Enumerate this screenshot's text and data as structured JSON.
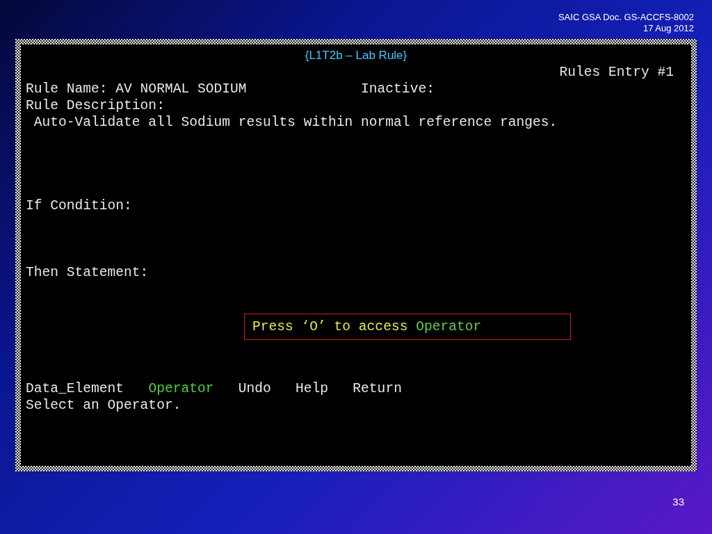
{
  "slide": {
    "doc_id": "SAIC GSA Doc. GS-ACCFS-8002",
    "date": "17 Aug 2012",
    "page_number": "33"
  },
  "terminal": {
    "title": "{L1T2b – Lab Rule}",
    "entry": "Rules Entry #1",
    "rule_name_label": "Rule Name: AV NORMAL SODIUM",
    "inactive_label": "Inactive:",
    "description_label": "Rule Description:",
    "description": "Auto-Validate all Sodium results within normal reference ranges.",
    "if_label": "If Condition:",
    "then_label": "Then Statement:",
    "menu": [
      {
        "label": "Data_Element",
        "selected": false
      },
      {
        "label": "Operator",
        "selected": true
      },
      {
        "label": "Undo",
        "selected": false
      },
      {
        "label": "Help",
        "selected": false
      },
      {
        "label": "Return",
        "selected": false
      }
    ],
    "message": "Select an Operator."
  },
  "callout": {
    "parts": [
      {
        "text": "Press ‘O’ to access",
        "kind": "hint"
      },
      {
        "text": "Operator",
        "kind": "command"
      }
    ]
  }
}
